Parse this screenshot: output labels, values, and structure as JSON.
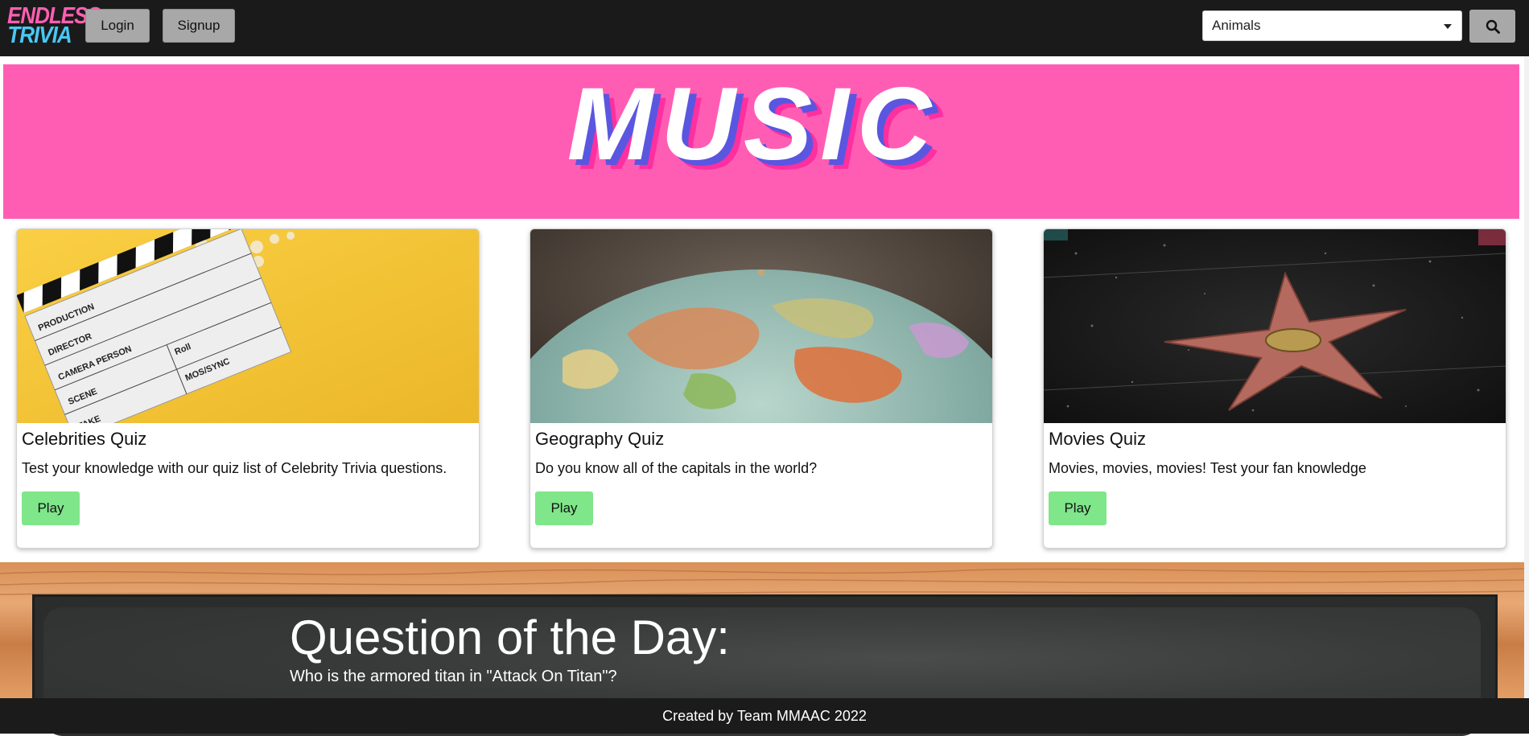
{
  "navbar": {
    "logo_line1": "ENDLESS",
    "logo_line2": "TRIVIA",
    "login_label": "Login",
    "signup_label": "Signup",
    "category_selected": "Animals",
    "search_icon": "search-icon"
  },
  "hero": {
    "title": "MUSIC",
    "background_color": "#ff5db4"
  },
  "cards": [
    {
      "title": "Celebrities Quiz",
      "text": "Test your knowledge with our quiz list of Celebrity Trivia questions.",
      "button": "Play",
      "image": "clapperboard-popcorn-image",
      "clapper_labels": [
        "PRODUCTION",
        "DIRECTOR",
        "CAMERA PERSON",
        "SCENE",
        "TAKE",
        "Roll",
        "MOS/SYNC"
      ]
    },
    {
      "title": "Geography Quiz",
      "text": "Do you know all of the capitals in the world?",
      "button": "Play",
      "image": "globe-image"
    },
    {
      "title": "Movies Quiz",
      "text": "Movies, movies, movies! Test your fan knowledge",
      "button": "Play",
      "image": "walk-of-fame-star-image"
    }
  ],
  "question_of_day": {
    "heading": "Question of the Day:",
    "question": "Who is the armored titan in \"Attack On Titan\"?"
  },
  "footer": {
    "text": "Created by Team MMAAC 2022"
  },
  "colors": {
    "navbar": "#1a1a1a",
    "play_button": "#7fe68a",
    "nav_button": "#a8a8a8"
  }
}
